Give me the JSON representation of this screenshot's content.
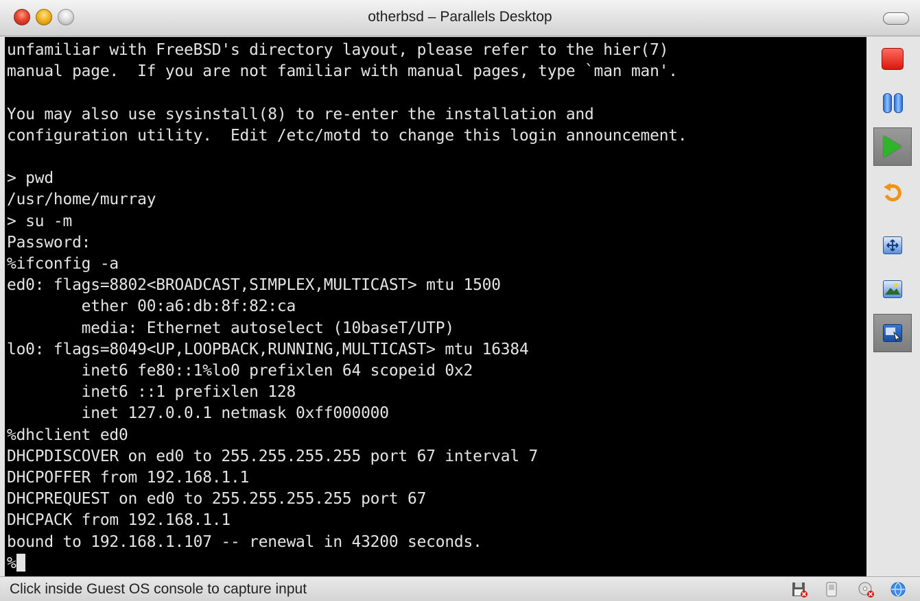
{
  "window": {
    "title": "otherbsd – Parallels Desktop"
  },
  "console": {
    "lines": [
      "unfamiliar with FreeBSD's directory layout, please refer to the hier(7)",
      "manual page.  If you are not familiar with manual pages, type `man man'.",
      "",
      "You may also use sysinstall(8) to re-enter the installation and",
      "configuration utility.  Edit /etc/motd to change this login announcement.",
      "",
      "> pwd",
      "/usr/home/murray",
      "> su -m",
      "Password:",
      "%ifconfig -a",
      "ed0: flags=8802<BROADCAST,SIMPLEX,MULTICAST> mtu 1500",
      "        ether 00:a6:db:8f:82:ca",
      "        media: Ethernet autoselect (10baseT/UTP)",
      "lo0: flags=8049<UP,LOOPBACK,RUNNING,MULTICAST> mtu 16384",
      "        inet6 fe80::1%lo0 prefixlen 64 scopeid 0x2",
      "        inet6 ::1 prefixlen 128",
      "        inet 127.0.0.1 netmask 0xff000000",
      "%dhclient ed0",
      "DHCPDISCOVER on ed0 to 255.255.255.255 port 67 interval 7",
      "DHCPOFFER from 192.168.1.1",
      "DHCPREQUEST on ed0 to 255.255.255.255 port 67",
      "DHCPACK from 192.168.1.1",
      "bound to 192.168.1.107 -- renewal in 43200 seconds."
    ],
    "prompt": "%"
  },
  "toolbar": {
    "buttons": [
      {
        "icon": "stop-icon",
        "selected": false
      },
      {
        "icon": "pause-icon",
        "selected": false
      },
      {
        "icon": "play-icon",
        "selected": true
      },
      {
        "icon": "restart-icon",
        "selected": false
      },
      {
        "icon": "fullscreen-icon",
        "selected": false
      },
      {
        "icon": "screenshot-icon",
        "selected": false
      },
      {
        "icon": "coherence-icon",
        "selected": true
      }
    ]
  },
  "statusbar": {
    "text": "Click inside Guest OS console to capture input",
    "icons": [
      "floppy-disk-icon",
      "hard-disk-icon",
      "cd-rom-icon",
      "network-icon"
    ]
  },
  "colors": {
    "console_bg": "#000000",
    "console_fg": "#e4e4e4",
    "play_green": "#2fb52a",
    "stop_red": "#d8180e"
  }
}
